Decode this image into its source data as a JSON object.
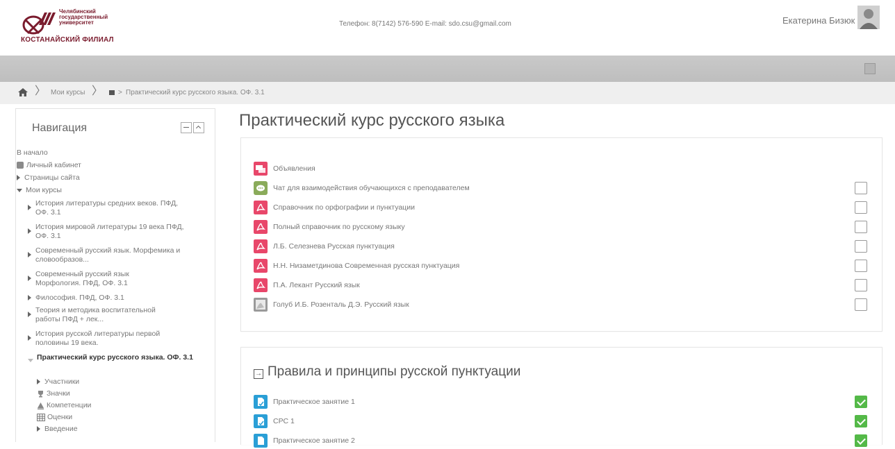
{
  "header": {
    "logo_top_text": "Челябинский государственный университет",
    "logo_bottom_text": "КОСТАНАЙСКИЙ ФИЛИАЛ",
    "contact": "Телефон: 8(7142) 576-590 E-mail: sdo.csu@gmail.com",
    "user_name": "Екатерина Бизюк"
  },
  "breadcrumb": {
    "my_courses": "Мои курсы",
    "course": "Практический курс русского языка. ОФ. 3.1"
  },
  "navigation": {
    "title": "Навигация",
    "items": [
      {
        "label": "В начало"
      },
      {
        "label": "Личный кабинет"
      },
      {
        "label": "Страницы сайта"
      },
      {
        "label": "Мои курсы"
      },
      {
        "label": "История литературы средних веков. ПФД, ОФ. 3.1"
      },
      {
        "label": "История мировой литературы 19 века ПФД, ОФ. 3.1"
      },
      {
        "label": "Современный русский язык. Морфемика и словообразов..."
      },
      {
        "label": "Современный русский язык Морфология. ПФД, ОФ. 3.1"
      },
      {
        "label": "Философия. ПФД, ОФ. 3.1"
      },
      {
        "label": "Теория и методика воспитательной работы ПФД + лек..."
      },
      {
        "label": "История русской литературы первой половины 19 века."
      },
      {
        "label": "Практический курс русского языка. ОФ. 3.1"
      },
      {
        "label": "Участники"
      },
      {
        "label": "Значки"
      },
      {
        "label": "Компетенции"
      },
      {
        "label": "Оценки"
      },
      {
        "label": "Введение"
      }
    ]
  },
  "main": {
    "title": "Практический курс русского языка",
    "section1": {
      "activities": [
        {
          "label": "Объявления",
          "icon": "forum-icon"
        },
        {
          "label": "Чат для взаимодействия обучающихся с преподавателем",
          "icon": "chat-icon"
        },
        {
          "label": "Справочник по орфографии и пунктуации",
          "icon": "pdf-icon"
        },
        {
          "label": "Полный справочник по русскому языку",
          "icon": "pdf-icon"
        },
        {
          "label": "Л.Б. Селезнева Русская пунктуация",
          "icon": "pdf-icon"
        },
        {
          "label": "Н.Н. Низаметдинова Современная русская пунктуация",
          "icon": "pdf-icon"
        },
        {
          "label": "П.А. Лекант Русский язык",
          "icon": "pdf-icon"
        },
        {
          "label": "Голуб И.Б. Розенталь Д.Э. Русский язык",
          "icon": "doc-icon"
        }
      ]
    },
    "section2": {
      "title": "Правила и принципы русской пунктуации",
      "activities": [
        {
          "label": "Практическое занятие 1",
          "completed": true
        },
        {
          "label": "СРС 1",
          "completed": true
        },
        {
          "label": "Практическое занятие 2",
          "completed": true
        }
      ]
    }
  },
  "colors": {
    "logo": "#7a1b2d",
    "pdf_icon": "#e8476a",
    "chat_icon": "#8aab5a",
    "assign_icon": "#2a9fd6",
    "checkbox_done": "#54b948"
  }
}
